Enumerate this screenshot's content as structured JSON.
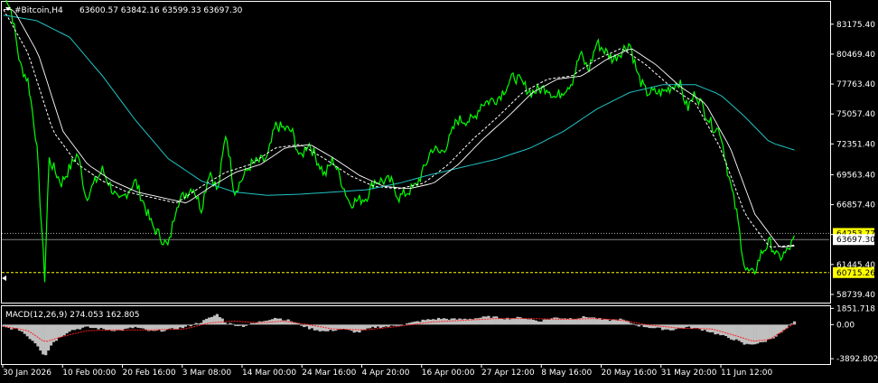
{
  "header": {
    "symbol": "#Bitcoin,H4",
    "ohlc": "63600.57 63842.16 63599.33 63697.30"
  },
  "macd_header": "MACD(12,26,9) 274.053 162.805",
  "colors": {
    "background": "#000000",
    "frame": "#ffffff",
    "price_line": "#00ff00",
    "ma_fast": "#ffffff",
    "ma_slow": "#20c4c4",
    "macd_hist": "#c0c0c0",
    "macd_signal": "#ff2020",
    "level_label_bg": "#ffff00",
    "current_label_bg": "#ffffff"
  },
  "chart_data": {
    "type": "line",
    "title": "#Bitcoin,H4",
    "x_ticks": [
      "30 Jan 2026",
      "10 Feb 00:00",
      "20 Feb 16:00",
      "3 Mar 08:00",
      "14 Mar 00:00",
      "24 Mar 16:00",
      "4 Apr 20:00",
      "16 Apr 00:00",
      "27 Apr 12:00",
      "8 May 16:00",
      "20 May 16:00",
      "31 May 20:00",
      "11 Jun 12:00"
    ],
    "price_ticks": [
      "83175.40",
      "80469.40",
      "77763.40",
      "75057.40",
      "72351.40",
      "69563.40",
      "66857.40",
      "64151.40",
      "61445.40",
      "58739.40"
    ],
    "macd_ticks": [
      "1851.718",
      "0.00",
      "-3892.802"
    ],
    "ylim": [
      58000,
      85200
    ],
    "macd_ylim": [
      -4500,
      2100
    ],
    "level_lines": [
      {
        "value": 64253.77,
        "label": "64253.77"
      },
      {
        "value": 60715.26,
        "label": "60715.26"
      }
    ],
    "current_price": {
      "value": 63697.3,
      "label": "63697.30"
    },
    "series": [
      {
        "values": [
          [
            0,
            86400
          ],
          [
            0.01,
            84200
          ],
          [
            0.02,
            79500
          ],
          [
            0.03,
            78000
          ],
          [
            0.04,
            72500
          ],
          [
            0.05,
            60000
          ],
          [
            0.055,
            71000
          ],
          [
            0.07,
            68800
          ],
          [
            0.09,
            71500
          ],
          [
            0.1,
            67500
          ],
          [
            0.12,
            70000
          ],
          [
            0.14,
            67000
          ],
          [
            0.16,
            69000
          ],
          [
            0.18,
            65000
          ],
          [
            0.2,
            63000
          ],
          [
            0.21,
            67000
          ],
          [
            0.23,
            68500
          ],
          [
            0.24,
            66500
          ],
          [
            0.25,
            70000
          ],
          [
            0.26,
            68000
          ],
          [
            0.27,
            73500
          ],
          [
            0.28,
            68000
          ],
          [
            0.3,
            70500
          ],
          [
            0.32,
            71000
          ],
          [
            0.33,
            74000
          ],
          [
            0.35,
            73500
          ],
          [
            0.36,
            71000
          ],
          [
            0.37,
            72500
          ],
          [
            0.39,
            69500
          ],
          [
            0.4,
            71000
          ],
          [
            0.42,
            67000
          ],
          [
            0.44,
            67500
          ],
          [
            0.45,
            69000
          ],
          [
            0.47,
            69000
          ],
          [
            0.48,
            67500
          ],
          [
            0.5,
            68500
          ],
          [
            0.51,
            70000
          ],
          [
            0.52,
            72000
          ],
          [
            0.53,
            71500
          ],
          [
            0.54,
            72500
          ],
          [
            0.55,
            74500
          ],
          [
            0.57,
            74500
          ],
          [
            0.58,
            76000
          ],
          [
            0.6,
            76500
          ],
          [
            0.62,
            78500
          ],
          [
            0.64,
            77000
          ],
          [
            0.66,
            77500
          ],
          [
            0.67,
            76500
          ],
          [
            0.69,
            78000
          ],
          [
            0.7,
            80500
          ],
          [
            0.71,
            79000
          ],
          [
            0.72,
            81500
          ],
          [
            0.74,
            80000
          ],
          [
            0.76,
            81500
          ],
          [
            0.77,
            78500
          ],
          [
            0.78,
            77000
          ],
          [
            0.8,
            77000
          ],
          [
            0.82,
            78000
          ],
          [
            0.83,
            75500
          ],
          [
            0.84,
            77000
          ],
          [
            0.86,
            74000
          ],
          [
            0.87,
            73500
          ],
          [
            0.88,
            69500
          ],
          [
            0.89,
            66000
          ],
          [
            0.9,
            61000
          ],
          [
            0.91,
            60500
          ],
          [
            0.92,
            62500
          ],
          [
            0.93,
            63500
          ],
          [
            0.94,
            62000
          ],
          [
            0.95,
            62500
          ],
          [
            0.96,
            63700
          ]
        ],
        "name": ""
      },
      {
        "values": [
          [
            0,
            84500
          ],
          [
            0.03,
            80500
          ],
          [
            0.06,
            73500
          ],
          [
            0.09,
            70500
          ],
          [
            0.12,
            69000
          ],
          [
            0.15,
            68000
          ],
          [
            0.18,
            67500
          ],
          [
            0.21,
            67000
          ],
          [
            0.24,
            68500
          ],
          [
            0.27,
            69800
          ],
          [
            0.3,
            70500
          ],
          [
            0.33,
            72000
          ],
          [
            0.36,
            72300
          ],
          [
            0.39,
            71000
          ],
          [
            0.42,
            69500
          ],
          [
            0.45,
            68500
          ],
          [
            0.48,
            68300
          ],
          [
            0.51,
            68800
          ],
          [
            0.54,
            70500
          ],
          [
            0.57,
            72800
          ],
          [
            0.6,
            74800
          ],
          [
            0.63,
            77000
          ],
          [
            0.66,
            78200
          ],
          [
            0.69,
            78500
          ],
          [
            0.72,
            80000
          ],
          [
            0.75,
            81000
          ],
          [
            0.78,
            79500
          ],
          [
            0.81,
            77500
          ],
          [
            0.84,
            76000
          ],
          [
            0.87,
            72000
          ],
          [
            0.9,
            66000
          ],
          [
            0.93,
            63000
          ],
          [
            0.96,
            63200
          ]
        ],
        "name": ""
      },
      {
        "values": [
          [
            0,
            84000
          ],
          [
            0.04,
            83500
          ],
          [
            0.08,
            82000
          ],
          [
            0.12,
            78500
          ],
          [
            0.16,
            74500
          ],
          [
            0.2,
            71000
          ],
          [
            0.24,
            69000
          ],
          [
            0.28,
            68000
          ],
          [
            0.32,
            67700
          ],
          [
            0.36,
            67800
          ],
          [
            0.4,
            68000
          ],
          [
            0.44,
            68200
          ],
          [
            0.48,
            68800
          ],
          [
            0.52,
            69600
          ],
          [
            0.56,
            70300
          ],
          [
            0.6,
            71000
          ],
          [
            0.64,
            72000
          ],
          [
            0.68,
            73500
          ],
          [
            0.72,
            75500
          ],
          [
            0.76,
            77000
          ],
          [
            0.8,
            77700
          ],
          [
            0.84,
            77700
          ],
          [
            0.87,
            76800
          ],
          [
            0.9,
            74800
          ],
          [
            0.93,
            72500
          ],
          [
            0.96,
            71800
          ]
        ],
        "name": ""
      }
    ],
    "macd": {
      "histogram": [
        [
          0,
          -300
        ],
        [
          0.02,
          -600
        ],
        [
          0.03,
          -1400
        ],
        [
          0.04,
          -2200
        ],
        [
          0.05,
          -3600
        ],
        [
          0.06,
          -2000
        ],
        [
          0.08,
          -700
        ],
        [
          0.1,
          -300
        ],
        [
          0.12,
          -500
        ],
        [
          0.14,
          -700
        ],
        [
          0.16,
          -300
        ],
        [
          0.18,
          -800
        ],
        [
          0.2,
          -600
        ],
        [
          0.22,
          -300
        ],
        [
          0.24,
          300
        ],
        [
          0.26,
          1200
        ],
        [
          0.27,
          200
        ],
        [
          0.29,
          -200
        ],
        [
          0.31,
          300
        ],
        [
          0.33,
          800
        ],
        [
          0.35,
          400
        ],
        [
          0.37,
          -400
        ],
        [
          0.39,
          -800
        ],
        [
          0.41,
          -500
        ],
        [
          0.43,
          -900
        ],
        [
          0.45,
          -300
        ],
        [
          0.47,
          -200
        ],
        [
          0.49,
          100
        ],
        [
          0.51,
          500
        ],
        [
          0.53,
          700
        ],
        [
          0.55,
          600
        ],
        [
          0.57,
          700
        ],
        [
          0.59,
          900
        ],
        [
          0.61,
          700
        ],
        [
          0.63,
          800
        ],
        [
          0.65,
          400
        ],
        [
          0.67,
          800
        ],
        [
          0.69,
          700
        ],
        [
          0.71,
          900
        ],
        [
          0.73,
          500
        ],
        [
          0.75,
          600
        ],
        [
          0.77,
          -100
        ],
        [
          0.79,
          -400
        ],
        [
          0.81,
          -600
        ],
        [
          0.83,
          -300
        ],
        [
          0.85,
          -600
        ],
        [
          0.87,
          -1200
        ],
        [
          0.89,
          -1800
        ],
        [
          0.9,
          -2300
        ],
        [
          0.92,
          -2100
        ],
        [
          0.94,
          -1200
        ],
        [
          0.96,
          270
        ]
      ],
      "signal": [
        [
          0,
          -200
        ],
        [
          0.03,
          -700
        ],
        [
          0.05,
          -2000
        ],
        [
          0.07,
          -1400
        ],
        [
          0.1,
          -700
        ],
        [
          0.14,
          -600
        ],
        [
          0.18,
          -600
        ],
        [
          0.22,
          -500
        ],
        [
          0.25,
          200
        ],
        [
          0.28,
          400
        ],
        [
          0.31,
          200
        ],
        [
          0.34,
          400
        ],
        [
          0.37,
          0
        ],
        [
          0.4,
          -500
        ],
        [
          0.44,
          -600
        ],
        [
          0.48,
          -200
        ],
        [
          0.52,
          300
        ],
        [
          0.56,
          500
        ],
        [
          0.6,
          700
        ],
        [
          0.64,
          700
        ],
        [
          0.68,
          600
        ],
        [
          0.72,
          700
        ],
        [
          0.75,
          500
        ],
        [
          0.78,
          0
        ],
        [
          0.82,
          -400
        ],
        [
          0.86,
          -500
        ],
        [
          0.89,
          -1300
        ],
        [
          0.91,
          -1900
        ],
        [
          0.93,
          -1700
        ],
        [
          0.96,
          160
        ]
      ]
    }
  }
}
